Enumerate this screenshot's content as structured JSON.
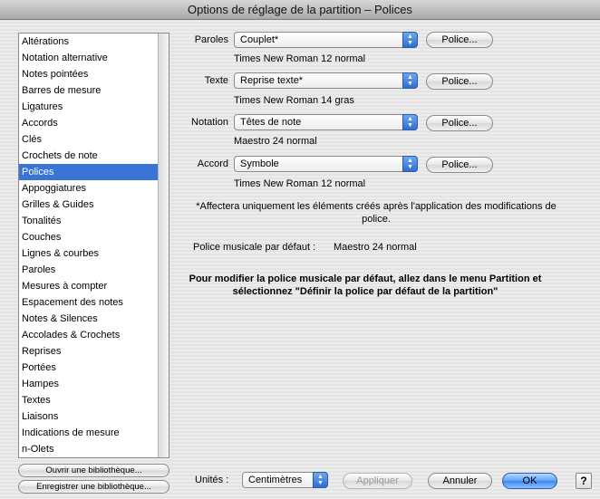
{
  "window": {
    "title": "Options de réglage de la partition – Polices"
  },
  "sidebar": {
    "items": [
      "Altérations",
      "Notation alternative",
      "Notes pointées",
      "Barres de mesure",
      "Ligatures",
      "Accords",
      "Clés",
      "Crochets de note",
      "Polices",
      "Appoggiatures",
      "Grilles & Guides",
      "Tonalités",
      "Couches",
      "Lignes & courbes",
      "Paroles",
      "Mesures à compter",
      "Espacement des notes",
      "Notes & Silences",
      "Accolades & Crochets",
      "Reprises",
      "Portées",
      "Hampes",
      "Textes",
      "Liaisons",
      "Indications de mesure",
      "n-Olets"
    ],
    "selected_index": 8,
    "open_library_label": "Ouvrir une bibliothèque...",
    "save_library_label": "Enregistrer une bibliothèque..."
  },
  "fonts": [
    {
      "label": "Paroles",
      "selected": "Couplet*",
      "button": "Police...",
      "info": "Times New Roman 12 normal"
    },
    {
      "label": "Texte",
      "selected": "Reprise texte*",
      "button": "Police...",
      "info": "Times New Roman 14 gras"
    },
    {
      "label": "Notation",
      "selected": "Têtes de note",
      "button": "Police...",
      "info": "Maestro 24 normal"
    },
    {
      "label": "Accord",
      "selected": "Symbole",
      "button": "Police...",
      "info": "Times New Roman 12 normal"
    }
  ],
  "note": "*Affectera uniquement les éléments créés après l'application des modifications de police.",
  "default_font": {
    "label": "Police musicale par défaut :",
    "value": "Maestro 24 normal"
  },
  "instruction": "Pour modifier la police musicale par défaut, allez dans le menu Partition et sélectionnez \"Définir la police par défaut de la partition\"",
  "footer": {
    "units_label": "Unités :",
    "units_value": "Centimètres",
    "apply_label": "Appliquer",
    "cancel_label": "Annuler",
    "ok_label": "OK",
    "help_label": "?"
  },
  "colors": {
    "selection": "#3875d7",
    "ok_button": "#3e86ec"
  }
}
